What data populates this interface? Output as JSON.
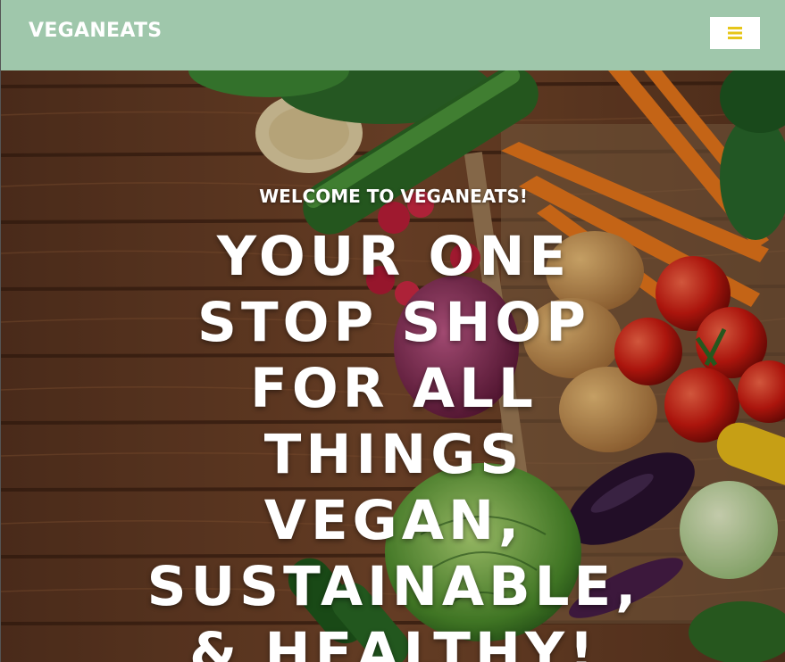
{
  "navbar": {
    "brand": "VEGANEATS",
    "menu_icon": "hamburger-menu-icon",
    "background_color": "#9fc7ab",
    "icon_color": "#e6c619"
  },
  "hero": {
    "kicker": "WELCOME TO VEGANEATS!",
    "headline": "YOUR ONE STOP SHOP FOR ALL THINGS VEGAN, SUSTAINABLE, & HEALTHY!",
    "background_image": "vegetables-on-wooden-table-photo"
  }
}
